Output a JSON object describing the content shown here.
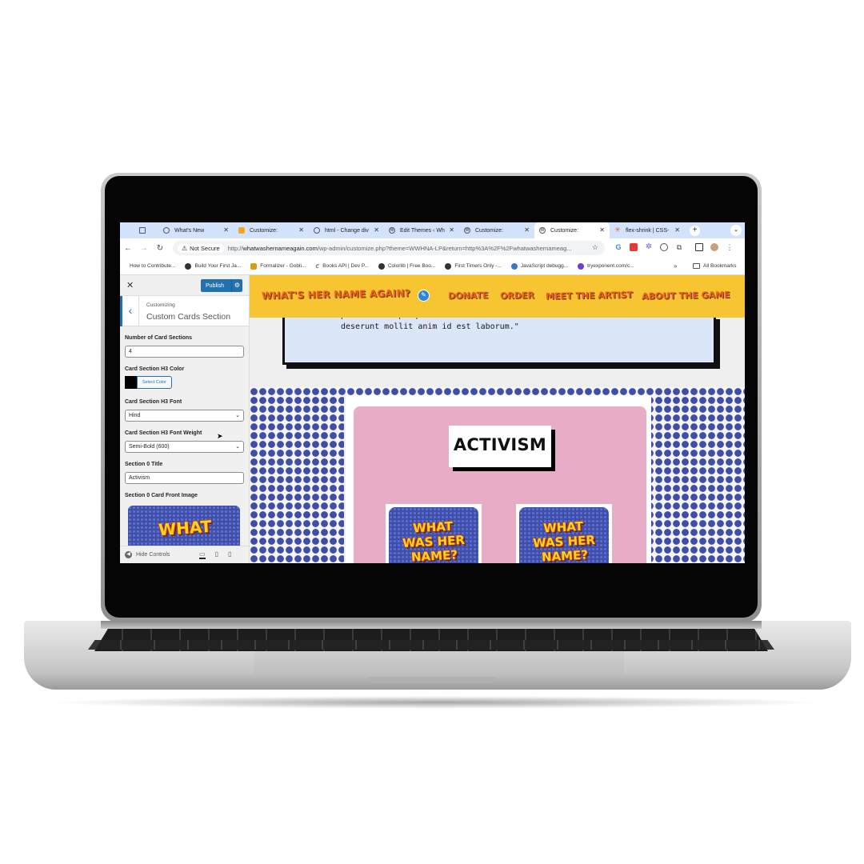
{
  "browser": {
    "tabs": [
      {
        "label": "",
        "icon": "tab-groups-icon"
      },
      {
        "label": "What's New",
        "icon": "chrome-icon"
      },
      {
        "label": "Customize:",
        "icon": "blogger-icon"
      },
      {
        "label": "html - Change div",
        "icon": "stackoverflow-icon"
      },
      {
        "label": "Edit Themes ‹ Wh",
        "icon": "wordpress-icon"
      },
      {
        "label": "Customize:",
        "icon": "wordpress-icon"
      },
      {
        "label": "Customize:",
        "icon": "wordpress-icon",
        "active": true
      },
      {
        "label": "flex-shrink | CSS-",
        "icon": "css-tricks-icon"
      }
    ],
    "not_secure": "Not Secure",
    "url_prefix": "http://",
    "url_host": "whatwashernameagain.com",
    "url_path": "/wp-admin/customize.php?theme=WWHNA-LP&return=http%3A%2F%2Fwhatwashernameag...",
    "bookmarks": [
      "How to Contribute...",
      "Build Your First Ja...",
      "Formalizer - Gobli...",
      "Books API | Dev P...",
      "Colorlib | Free Boo...",
      "First Timers Only -...",
      "JavaScript debugg...",
      "tryexponent.com/c..."
    ],
    "more_bookmarks": "»",
    "all_bookmarks": "All Bookmarks"
  },
  "customizer": {
    "close": "✕",
    "publish": "Publish",
    "customizing": "Customizing",
    "section_title": "Custom Cards Section",
    "fields": {
      "num_sections_label": "Number of Card Sections",
      "num_sections_value": "4",
      "h3_color_label": "Card Section H3 Color",
      "h3_color_value": "#000000",
      "select_color": "Select Color",
      "h3_font_label": "Card Section H3 Font",
      "h3_font_value": "Hind",
      "h3_weight_label": "Card Section H3 Font Weight",
      "h3_weight_value": "Semi-Bold (600)",
      "section0_title_label": "Section 0 Title",
      "section0_title_value": "Activism",
      "section0_image_label": "Section 0 Card Front Image",
      "image_text": "WHAT"
    },
    "hide_controls": "Hide Controls"
  },
  "site": {
    "logo": "WHAT'S HER NAME AGAIN?",
    "nav": [
      "DONATE",
      "ORDER",
      "MEET THE ARTIST",
      "ABOUT THE GAME"
    ],
    "quote_line1": "proident culpa qui officia",
    "quote_line2": "deserunt mollit anim id est laborum.\"",
    "section_heading": "ACTIVISM",
    "card_text": [
      "WHAT",
      "WAS HER",
      "NAME?"
    ]
  },
  "colors": {
    "nav_bg": "#f7c531",
    "nav_text": "#e8641e",
    "publish_blue": "#2271b1",
    "pink_panel": "#e8adc6",
    "dots": "#3f4fa8"
  }
}
